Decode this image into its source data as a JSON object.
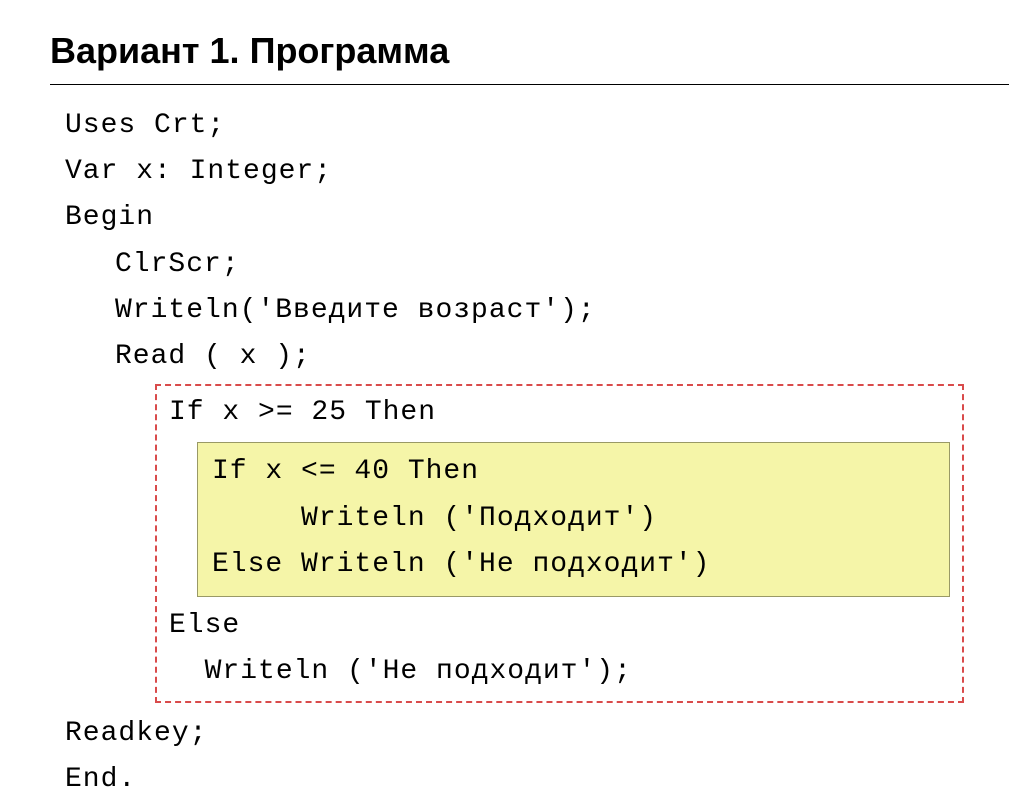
{
  "title": "Вариант 1. Программа",
  "code": {
    "l1": "Uses Crt;",
    "l2": "Var x: Integer;",
    "l3": "Begin",
    "l4": "ClrScr;",
    "l5": "Writeln('Введите возраст');",
    "l6": "Read ( x );",
    "l7": "If x >= 25 Then",
    "l8": "If x <= 40 Then",
    "l9": "     Writeln ('Подходит')",
    "l10": "Else Writeln ('Не подходит')",
    "l11": "Else",
    "l12": "  Writeln ('Не подходит');",
    "l13": "Readkey;",
    "l14": "End."
  }
}
